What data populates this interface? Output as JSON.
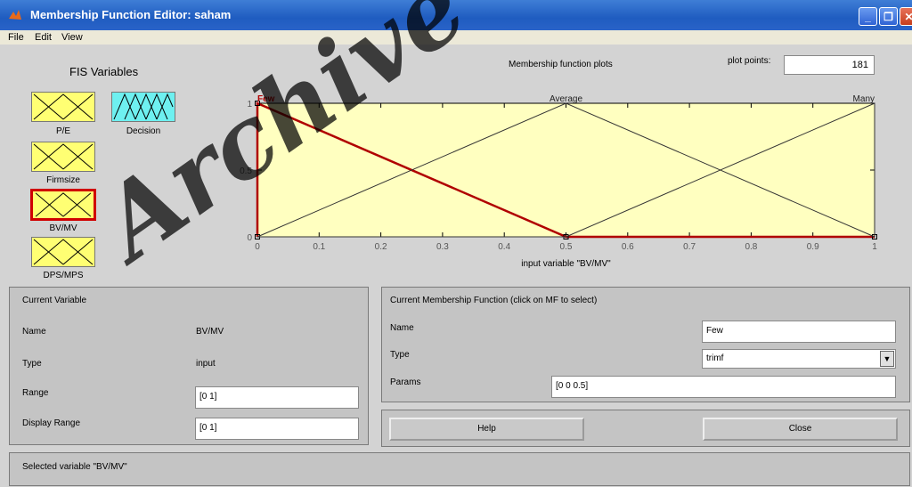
{
  "window": {
    "title": "Membership Function Editor: saham",
    "accent": "#245edb"
  },
  "menu": {
    "file": "File",
    "edit": "Edit",
    "view": "View"
  },
  "fis": {
    "title": "FIS Variables",
    "variables": [
      {
        "label": "P/E",
        "color": "#ffff73"
      },
      {
        "label": "Decision",
        "color": "#6ef0f0"
      },
      {
        "label": "Firmsize",
        "color": "#ffff73"
      },
      {
        "label": "BV/MV",
        "color": "#ffff73",
        "selected": true
      },
      {
        "label": "DPS/MPS",
        "color": "#ffff73"
      }
    ]
  },
  "plot": {
    "title": "Membership function plots",
    "plot_points_label": "plot points:",
    "plot_points_value": "181",
    "xlabel": "input variable \"BV/MV\"",
    "x_ticks": [
      "0",
      "0.1",
      "0.2",
      "0.3",
      "0.4",
      "0.5",
      "0.6",
      "0.7",
      "0.8",
      "0.9",
      "1"
    ],
    "y_ticks": [
      "0",
      "0.5",
      "1"
    ],
    "mf_labels": [
      "Few",
      "Average",
      "Many"
    ],
    "selected_color": "#b00000",
    "bg_color": "#ffffc0"
  },
  "chart_data": {
    "type": "line",
    "xlabel": "input variable \"BV/MV\"",
    "ylabel": "",
    "xlim": [
      0,
      1
    ],
    "ylim": [
      0,
      1
    ],
    "series": [
      {
        "name": "Few",
        "x": [
          0,
          0,
          0.5,
          1
        ],
        "y": [
          0,
          1,
          0,
          0
        ]
      },
      {
        "name": "Average",
        "x": [
          0,
          0.5,
          1
        ],
        "y": [
          0,
          1,
          0
        ]
      },
      {
        "name": "Many",
        "x": [
          0,
          0.5,
          1,
          1
        ],
        "y": [
          0,
          0,
          1,
          0
        ]
      }
    ]
  },
  "current_variable": {
    "title": "Current Variable",
    "name_label": "Name",
    "name_value": "BV/MV",
    "type_label": "Type",
    "type_value": "input",
    "range_label": "Range",
    "range_value": "[0 1]",
    "display_range_label": "Display Range",
    "display_range_value": "[0 1]"
  },
  "current_mf": {
    "title": "Current Membership Function (click on MF to select)",
    "name_label": "Name",
    "name_value": "Few",
    "type_label": "Type",
    "type_value": "trimf",
    "params_label": "Params",
    "params_value": "[0 0 0.5]"
  },
  "buttons": {
    "help": "Help",
    "close": "Close"
  },
  "status": "Selected variable \"BV/MV\"",
  "watermark": "Archive of"
}
